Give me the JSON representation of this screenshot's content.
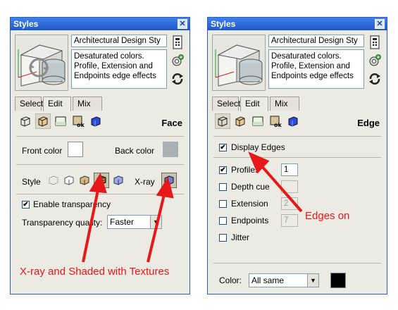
{
  "colors": {
    "accent_red": "#e8181a",
    "title_blue": "#2b5fc4"
  },
  "left_panel": {
    "title": "Styles",
    "style_name": "Architectural Design Sty",
    "description": "Desaturated colors. Profile, Extension and Endpoints edge effects",
    "tabs": [
      "Select",
      "Edit",
      "Mix"
    ],
    "mode_label": "Face",
    "front_color_label": "Front color",
    "back_color_label": "Back color",
    "front_color": "#ffffff",
    "back_color": "#a9b1b5",
    "style_label": "Style",
    "xray_label": "X-ray",
    "enable_transparency_label": "Enable transparency",
    "transparency_quality_label": "Transparency quality:",
    "transparency_quality_value": "Faster"
  },
  "right_panel": {
    "title": "Styles",
    "style_name": "Architectural Design Sty",
    "description": "Desaturated colors. Profile, Extension and Endpoints edge effects",
    "tabs": [
      "Select",
      "Edit",
      "Mix"
    ],
    "mode_label": "Edge",
    "display_edges_label": "Display Edges",
    "profiles_label": "Profiles",
    "profiles_value": "1",
    "depth_cue_label": "Depth cue",
    "extension_label": "Extension",
    "extension_value": "2",
    "endpoints_label": "Endpoints",
    "endpoints_value": "7",
    "jitter_label": "Jitter",
    "color_label": "Color:",
    "color_value": "All same",
    "edge_color": "#000000"
  },
  "annotations": {
    "left": "X-ray and Shaded with Textures",
    "right": "Edges on"
  }
}
